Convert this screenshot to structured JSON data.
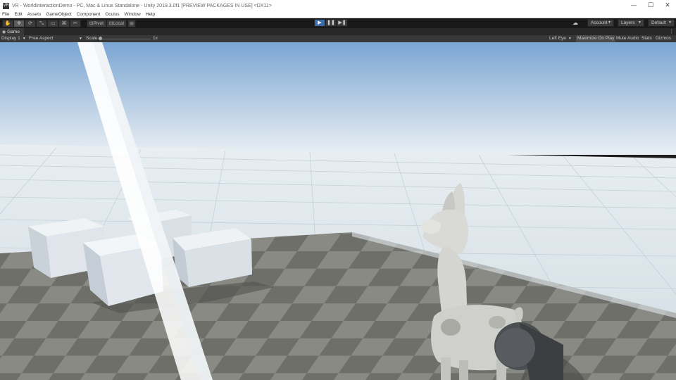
{
  "window": {
    "app_icon": "VR",
    "title": "VR - WorldInteractionDemo - PC, Mac & Linux Standalone - Unity 2019.3.0f1 [PREVIEW PACKAGES IN USE] <DX11>",
    "controls": {
      "minimize": "—",
      "maximize": "☐",
      "close": "✕"
    }
  },
  "menu": {
    "items": [
      "File",
      "Edit",
      "Assets",
      "GameObject",
      "Component",
      "Oculus",
      "Window",
      "Help"
    ]
  },
  "toolbar": {
    "tools": [
      {
        "name": "hand-tool",
        "icon": "✋"
      },
      {
        "name": "move-tool",
        "icon": "✥"
      },
      {
        "name": "rotate-tool",
        "icon": "⟳"
      },
      {
        "name": "scale-tool",
        "icon": "⤡"
      },
      {
        "name": "rect-tool",
        "icon": "▭"
      },
      {
        "name": "transform-tool",
        "icon": "⌘"
      },
      {
        "name": "custom-tool",
        "icon": "✂"
      }
    ],
    "pivot_label": "Pivot",
    "local_label": "Local",
    "play": {
      "play": "▶",
      "pause": "❚❚",
      "step": "▶❚"
    },
    "cloud_icon": "☁",
    "account_label": "Account",
    "layers_label": "Layers",
    "layout_label": "Default"
  },
  "tab": {
    "label": "Game",
    "icon": "◉",
    "menu_icon": "⋮"
  },
  "gameview": {
    "display": "Display 1",
    "aspect": "Free Aspect",
    "scale_label": "Scale",
    "scale_value": "1x",
    "eye": "Left Eye",
    "maximize": "Maximize On Play",
    "mute": "Mute Audio",
    "stats": "Stats",
    "gizmos": "Gizmos"
  },
  "colors": {
    "play_active": "#3e6aa8",
    "sky_top": "#7ea8d6",
    "sky_horizon": "#e8eef3"
  }
}
